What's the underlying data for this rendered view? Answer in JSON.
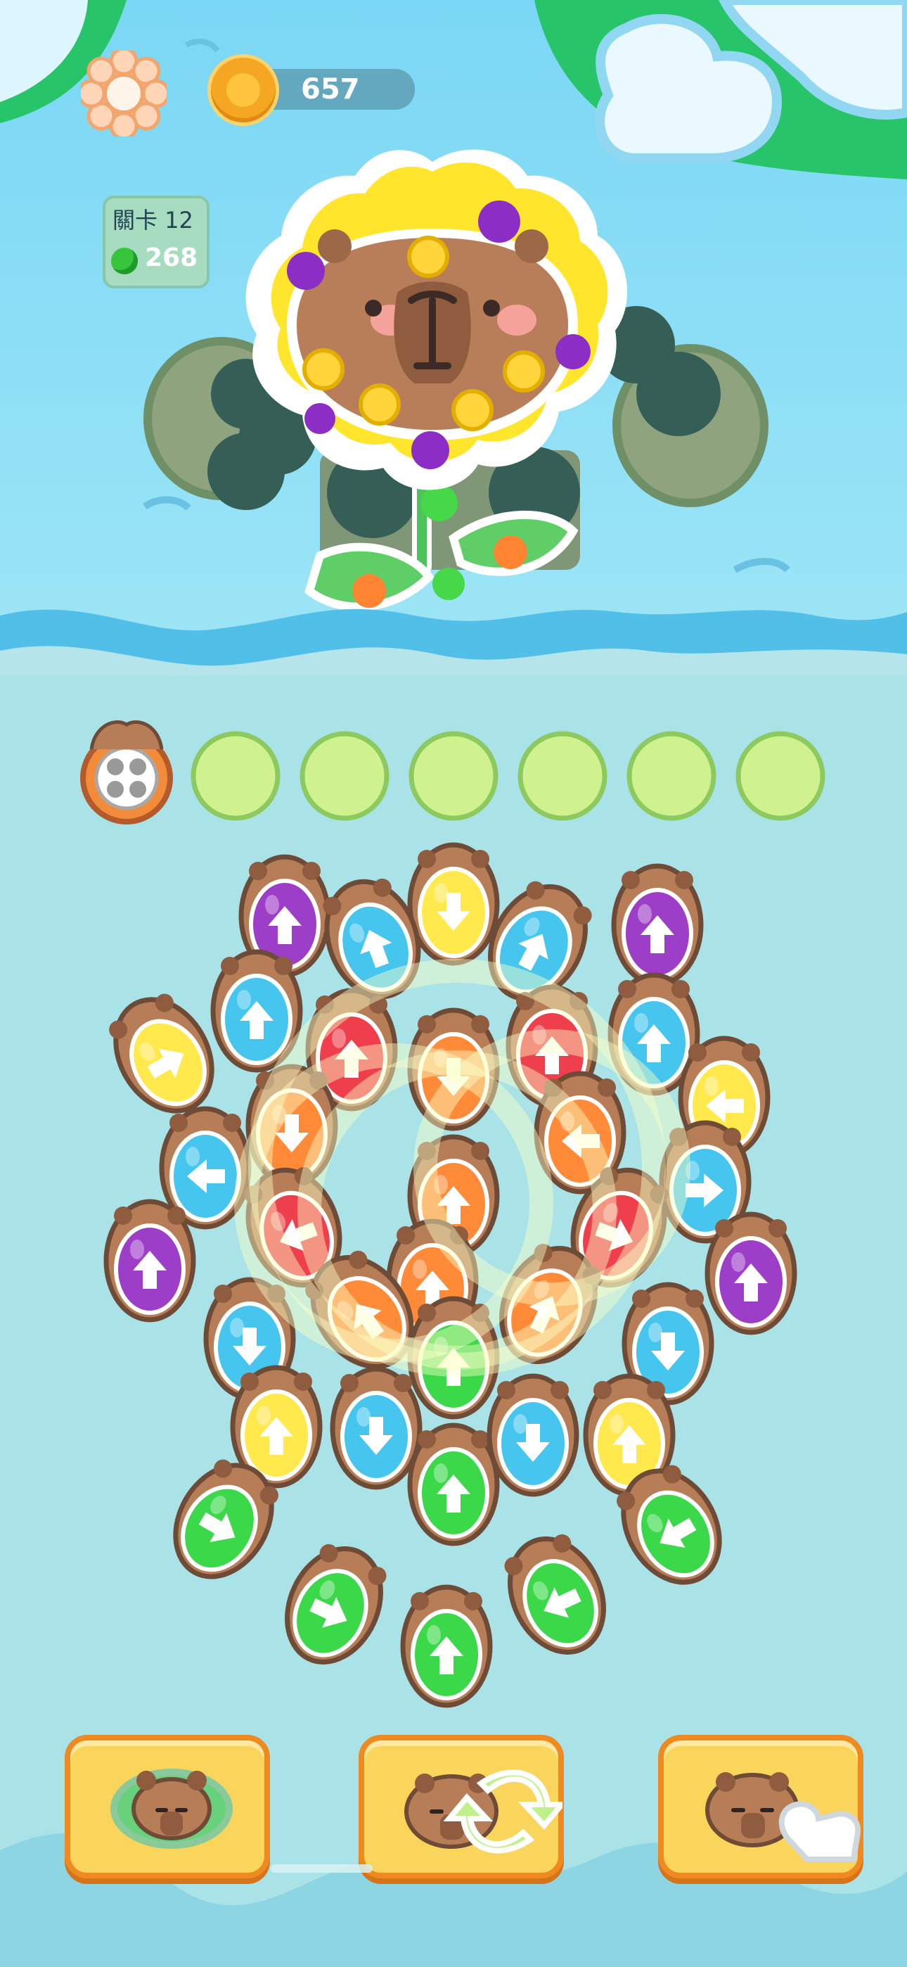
{
  "hud": {
    "coins": "657",
    "level_label": "關卡 12",
    "gems": "268",
    "settings_icon": "gear-icon",
    "coin_icon": "coin-icon",
    "gem_icon": "green-gem-icon"
  },
  "slots": {
    "filled": 1,
    "total": 7,
    "first_slot_content": "capybara-with-item-tray"
  },
  "board": {
    "arrow_colors": [
      "yellow",
      "purple",
      "blue",
      "red",
      "orange",
      "green"
    ],
    "colors": {
      "yellow": "#ffe94d",
      "purple": "#9d3ec8",
      "blue": "#46c6ef",
      "red": "#ef3f4d",
      "orange": "#ff8a38",
      "green": "#3bd84a"
    }
  },
  "tools": {
    "left": "capybara-lilypad-icon",
    "middle": "capybara-swap-icon",
    "right": "capybara-tap-icon"
  }
}
